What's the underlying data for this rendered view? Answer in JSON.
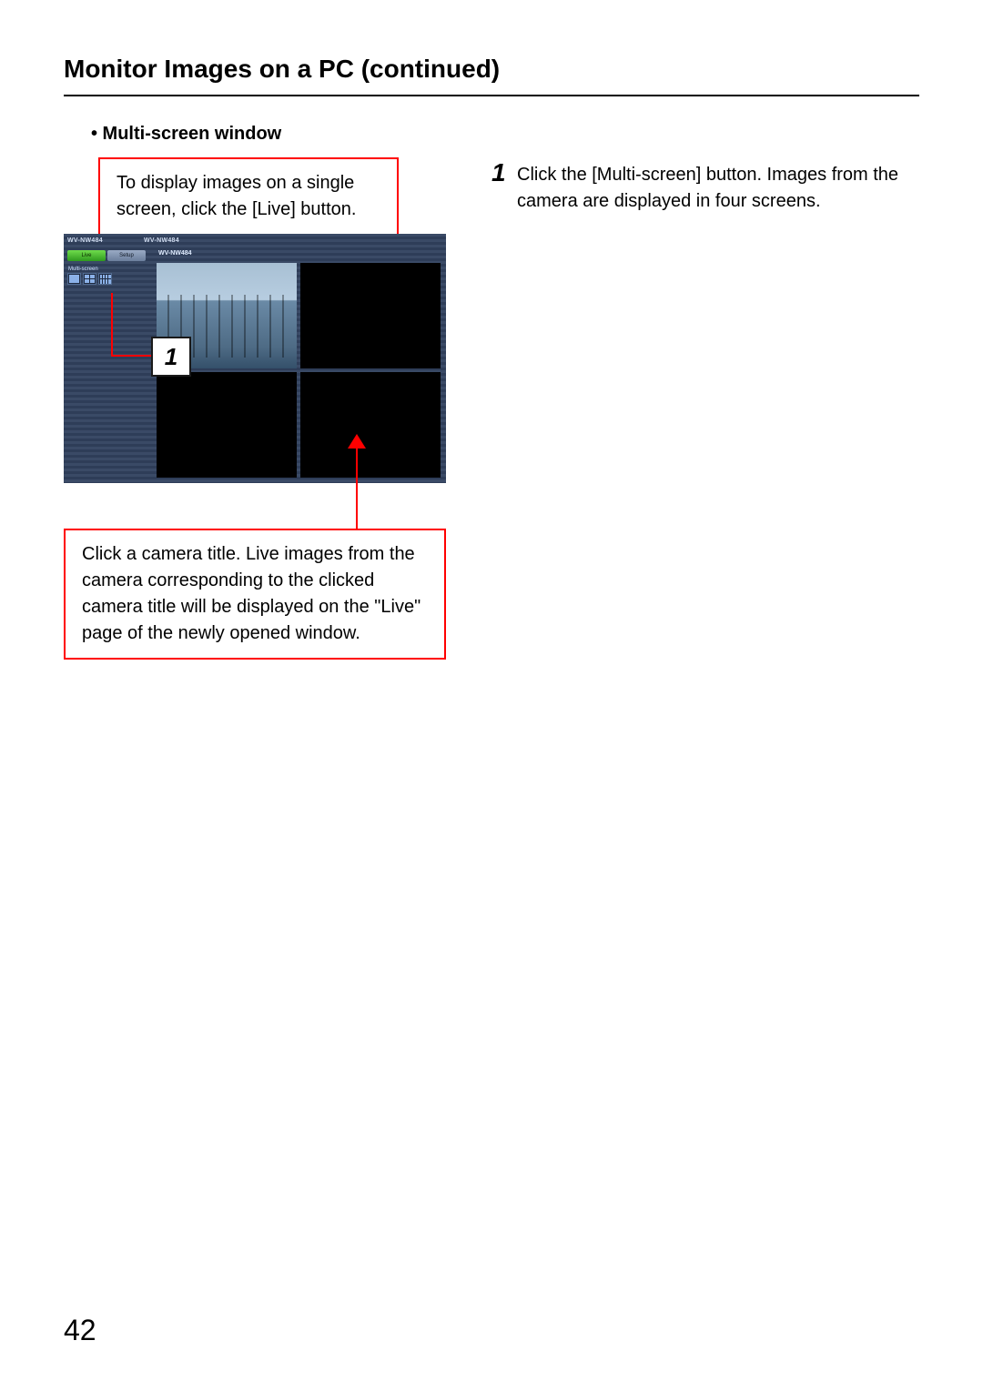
{
  "title": "Monitor Images on a PC (continued)",
  "bullet_heading": "•  Multi-screen window",
  "callout_top": "To display images on a single screen, click the [Live] button.",
  "callout_bottom": "Click a camera title. Live images from the camera corresponding to the clicked camera title will be displayed on the \"Live\" page of the newly opened window.",
  "step": {
    "num": "1",
    "text": "Click the [Multi-screen] button. Images from the camera are displayed in four screens."
  },
  "shot": {
    "model_left": "WV-NW484",
    "model_right": "WV-NW484",
    "live": "Live",
    "setup": "Setup",
    "ms_label": "Multi-screen",
    "cam_title": "WV-NW484"
  },
  "step_chip": "1",
  "page_number": "42"
}
